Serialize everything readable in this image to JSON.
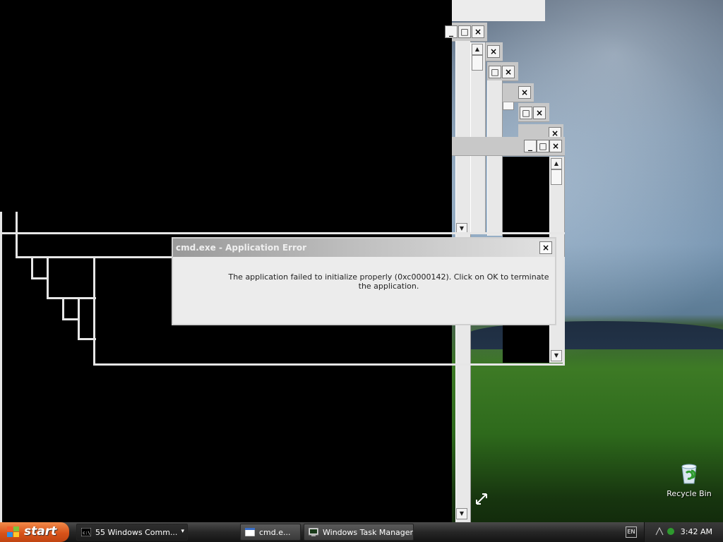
{
  "dialog": {
    "title": "cmd.exe - Application Error",
    "message": "The application failed to initialize properly (0xc0000142). Click on OK to terminate the application.",
    "close_glyph": "×"
  },
  "window_buttons": {
    "minimize": "_",
    "maximize": "□",
    "close": "×"
  },
  "scroll": {
    "up": "▲",
    "down": "▼"
  },
  "taskbar": {
    "start_label": "start",
    "tasks": [
      {
        "label": "55 Windows Comm...",
        "icon": "cmd-icon",
        "dropdown": "▾"
      },
      {
        "label": "cmd.e...",
        "icon": "window-icon"
      },
      {
        "label": "Windows Task Manager",
        "icon": "task-manager-icon"
      }
    ],
    "language": "EN",
    "clock": "3:42 AM"
  },
  "desktop": {
    "recycle_bin_label": "Recycle Bin"
  },
  "colors": {
    "start_button": "#d8531a",
    "taskbar": "#262626",
    "dialog_bg": "#ececec"
  }
}
